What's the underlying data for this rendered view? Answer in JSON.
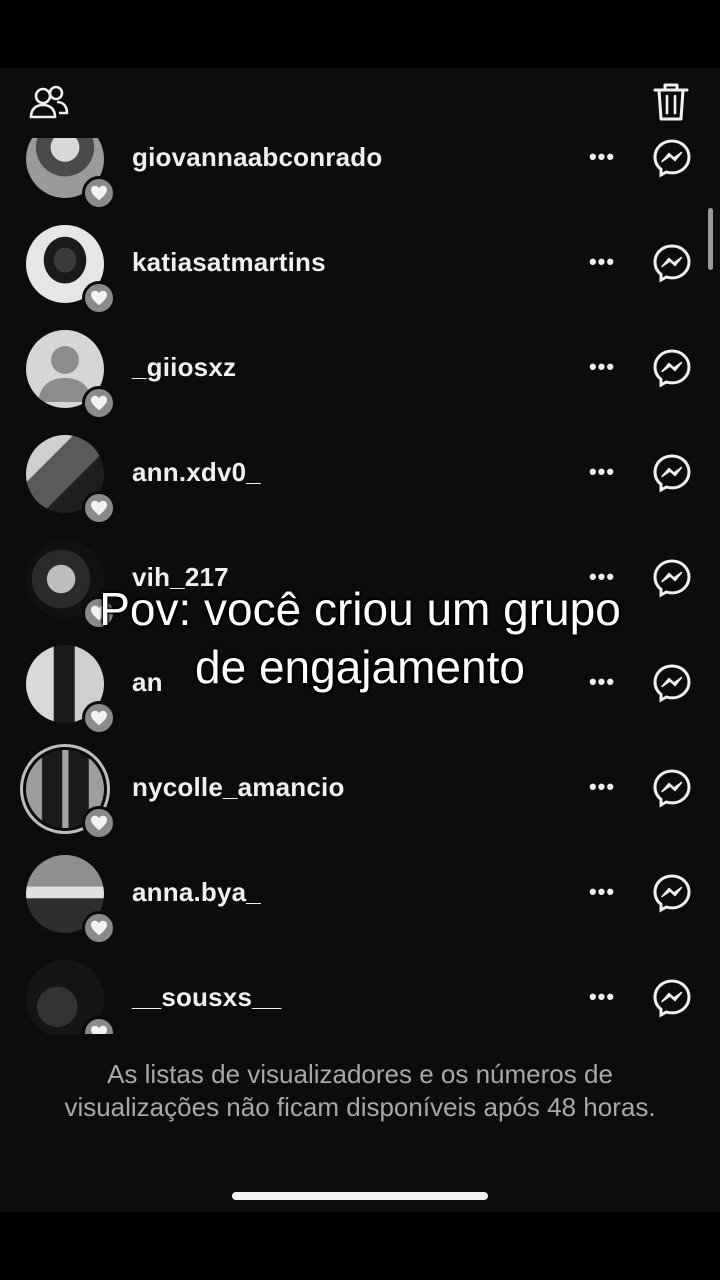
{
  "caption": {
    "line1": "Pov: você criou um grupo",
    "line2": "de engajamento"
  },
  "header": {
    "left_icon": "people-icon",
    "right_icon": "trash-icon"
  },
  "viewers": [
    {
      "username": "giovannaabconrado",
      "more_label": "•••",
      "avatar": "photo-dark-hair",
      "story_ring": false
    },
    {
      "username": "katiasatmartins",
      "more_label": "•••",
      "avatar": "photo-white-bg",
      "story_ring": false
    },
    {
      "username": "_giiosxz",
      "more_label": "•••",
      "avatar": "default-avatar",
      "story_ring": false
    },
    {
      "username": "ann.xdv0_",
      "more_label": "•••",
      "avatar": "photo-mirror",
      "story_ring": false
    },
    {
      "username": "vih_217",
      "more_label": "•••",
      "avatar": "photo-curly-hair",
      "story_ring": false
    },
    {
      "username": "an",
      "more_label": "•••",
      "avatar": "photo-standing",
      "story_ring": false
    },
    {
      "username": "nycolle_amancio",
      "more_label": "•••",
      "avatar": "photo-two-people",
      "story_ring": true
    },
    {
      "username": "anna.bya_",
      "more_label": "•••",
      "avatar": "photo-outdoor",
      "story_ring": false
    },
    {
      "username": "__sousxs__",
      "more_label": "•••",
      "avatar": "photo-dark",
      "story_ring": false
    }
  ],
  "footer": {
    "note": "As listas de visualizadores e os números de visualizações não ficam disponíveis após 48 horas."
  },
  "colors": {
    "background": "#0c0c0d",
    "text": "#f0f0f0",
    "muted": "#a8a8a8"
  }
}
